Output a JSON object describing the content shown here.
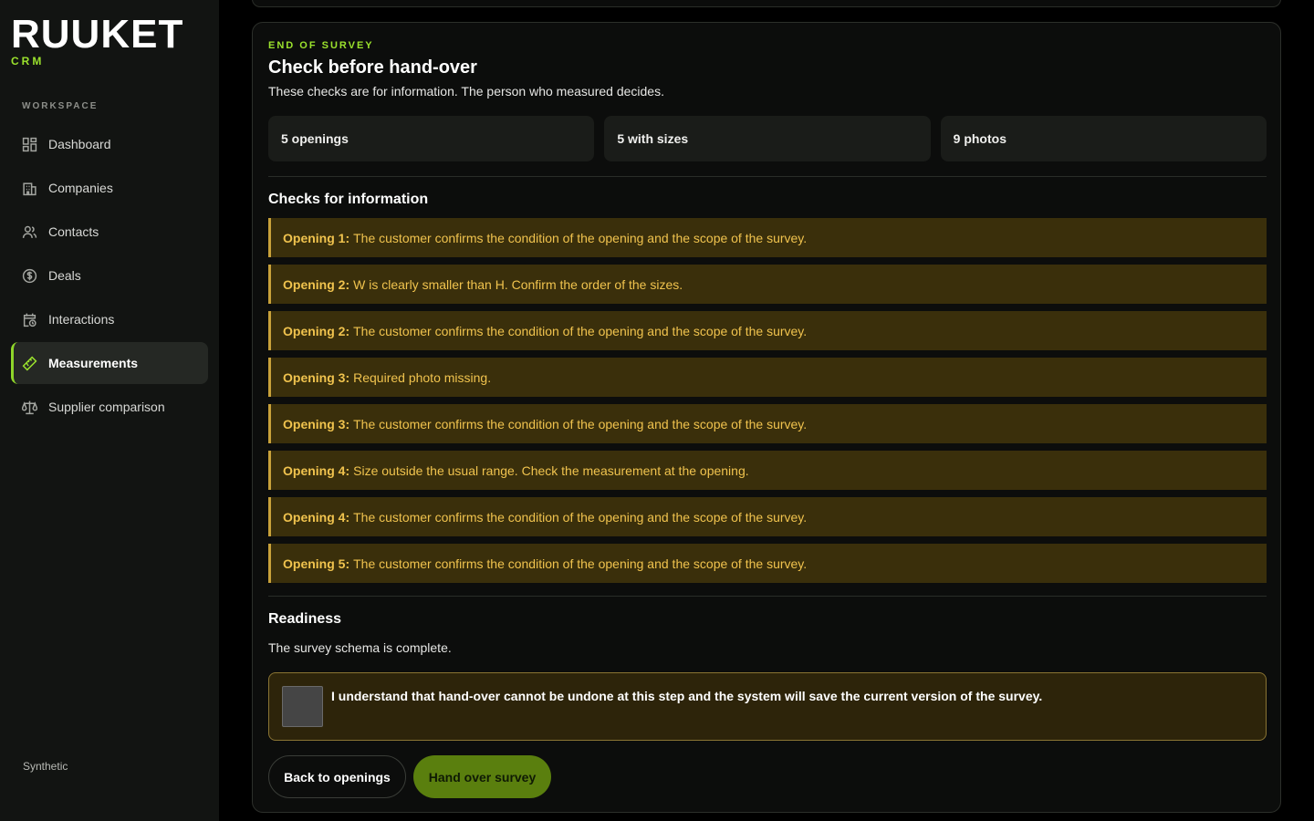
{
  "brand": {
    "name": "RUUKET",
    "sub": "CRM",
    "accent": "#9be22d"
  },
  "sidebar": {
    "section_label": "WORKSPACE",
    "items": [
      {
        "label": "Dashboard",
        "icon": "dashboard-icon"
      },
      {
        "label": "Companies",
        "icon": "building-icon"
      },
      {
        "label": "Contacts",
        "icon": "contacts-icon"
      },
      {
        "label": "Deals",
        "icon": "dollar-icon"
      },
      {
        "label": "Interactions",
        "icon": "calendar-clock-icon"
      },
      {
        "label": "Measurements",
        "icon": "ruler-icon",
        "active": true
      },
      {
        "label": "Supplier comparison",
        "icon": "scale-icon"
      }
    ],
    "footer": "Synthetic"
  },
  "main": {
    "eyebrow": "END OF SURVEY",
    "title": "Check before hand-over",
    "subtitle": "These checks are for information. The person who measured decides.",
    "stats": [
      "5 openings",
      "5 with sizes",
      "9 photos"
    ],
    "checks_title": "Checks for information",
    "checks": [
      {
        "opening": "Opening 1:",
        "text": "The customer confirms the condition of the opening and the scope of the survey."
      },
      {
        "opening": "Opening 2:",
        "text": "W is clearly smaller than H. Confirm the order of the sizes."
      },
      {
        "opening": "Opening 2:",
        "text": "The customer confirms the condition of the opening and the scope of the survey."
      },
      {
        "opening": "Opening 3:",
        "text": "Required photo missing."
      },
      {
        "opening": "Opening 3:",
        "text": "The customer confirms the condition of the opening and the scope of the survey."
      },
      {
        "opening": "Opening 4:",
        "text": "Size outside the usual range. Check the measurement at the opening."
      },
      {
        "opening": "Opening 4:",
        "text": "The customer confirms the condition of the opening and the scope of the survey."
      },
      {
        "opening": "Opening 5:",
        "text": "The customer confirms the condition of the opening and the scope of the survey."
      }
    ],
    "readiness_title": "Readiness",
    "readiness_text": "The survey schema is complete.",
    "confirm_text": "I understand that hand-over cannot be undone at this step and the system will save the current version of the survey.",
    "back_button": "Back to openings",
    "handover_button": "Hand over survey"
  }
}
